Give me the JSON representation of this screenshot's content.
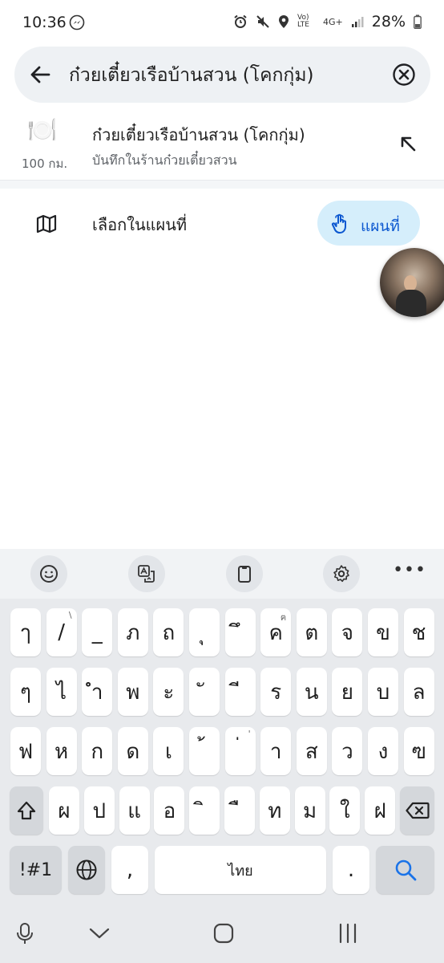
{
  "status": {
    "time": "10:36",
    "network": "4G+",
    "volte": "Vo) LTE",
    "battery": "28%"
  },
  "search": {
    "query": "ก๋วยเตี๋ยวเรือบ้านสวน (โคกกุ่ม)"
  },
  "suggestion": {
    "icon": "🍽️",
    "distance": "100 กม.",
    "title": "ก๋วยเตี๋ยวเรือบ้านสวน (โคกกุ่ม)",
    "subtitle": "บันทึกในร้านก๋วยเตี๋ยวสวน"
  },
  "map_option": {
    "label": "เลือกในแผนที่",
    "chip_label": "แผนที่"
  },
  "keyboard": {
    "row1": [
      {
        "k": "ๅ",
        "h": ""
      },
      {
        "k": "/",
        "h": "\\"
      },
      {
        "k": "_",
        "h": ""
      },
      {
        "k": "ภ",
        "h": ""
      },
      {
        "k": "ถ",
        "h": ""
      },
      {
        "k": "ุ",
        "h": ""
      },
      {
        "k": "ึ",
        "h": ""
      },
      {
        "k": "ค",
        "h": "ฅ"
      },
      {
        "k": "ต",
        "h": ""
      },
      {
        "k": "จ",
        "h": ""
      },
      {
        "k": "ข",
        "h": ""
      },
      {
        "k": "ช",
        "h": ""
      }
    ],
    "row2": [
      "ๆ",
      "ไ",
      "ำ",
      "พ",
      "ะ",
      "ั",
      "ี",
      "ร",
      "น",
      "ย",
      "บ",
      "ล"
    ],
    "row3": [
      {
        "k": "ฟ",
        "h": ""
      },
      {
        "k": "ห",
        "h": ""
      },
      {
        "k": "ก",
        "h": ""
      },
      {
        "k": "ด",
        "h": ""
      },
      {
        "k": "เ",
        "h": ""
      },
      {
        "k": "้",
        "h": ""
      },
      {
        "k": "่",
        "h": "'"
      },
      {
        "k": "า",
        "h": ""
      },
      {
        "k": "ส",
        "h": ""
      },
      {
        "k": "ว",
        "h": ""
      },
      {
        "k": "ง",
        "h": ""
      },
      {
        "k": "ฃ",
        "h": ""
      }
    ],
    "row4": [
      "ผ",
      "ป",
      "แ",
      "อ",
      "ิ",
      "ื",
      "ท",
      "ม",
      "ใ",
      "ฝ"
    ],
    "symbols_label": "!#1",
    "comma": ",",
    "space_label": "ไทย",
    "period": "."
  },
  "colors": {
    "accent": "#0b57d0",
    "chip_bg": "#d5eefb",
    "search_bg": "#eef1f4",
    "keyboard_bg": "#e8eaed"
  }
}
